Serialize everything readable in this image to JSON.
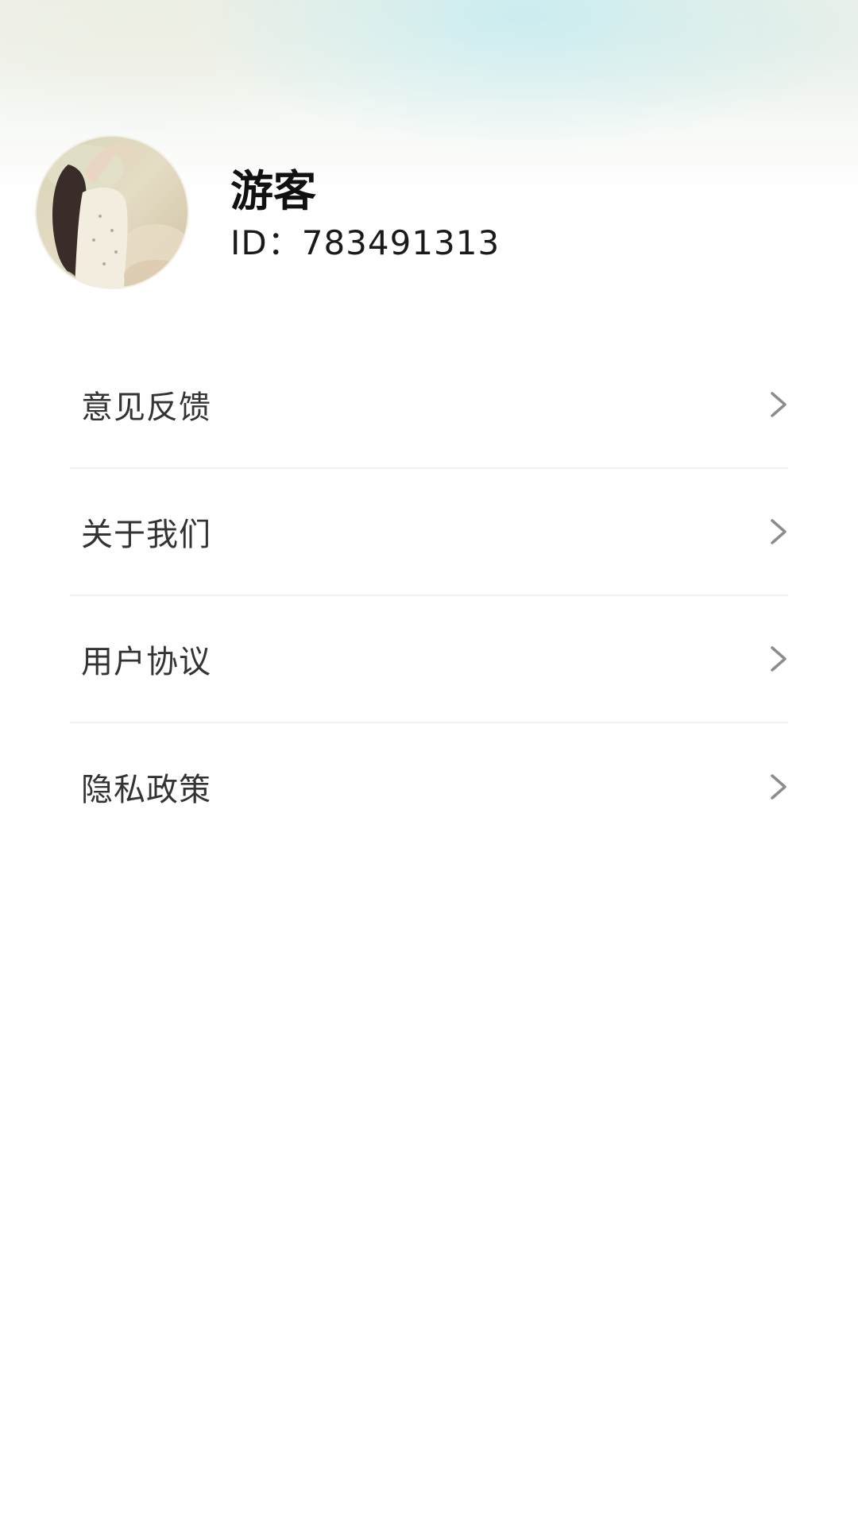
{
  "profile": {
    "name": "游客",
    "id_text": "ID：783491313",
    "avatar_icon": "user-avatar-photo"
  },
  "menu": {
    "items": [
      {
        "label": "意见反馈",
        "icon": "chevron-right-icon"
      },
      {
        "label": "关于我们",
        "icon": "chevron-right-icon"
      },
      {
        "label": "用户协议",
        "icon": "chevron-right-icon"
      },
      {
        "label": "隐私政策",
        "icon": "chevron-right-icon"
      }
    ]
  },
  "colors": {
    "background": "#ffffff",
    "header_tint": "#c4ecf0",
    "text_primary": "#111111",
    "text_menu": "#333333",
    "chevron": "#8c8c8c",
    "divider": "#f0f0f0"
  }
}
